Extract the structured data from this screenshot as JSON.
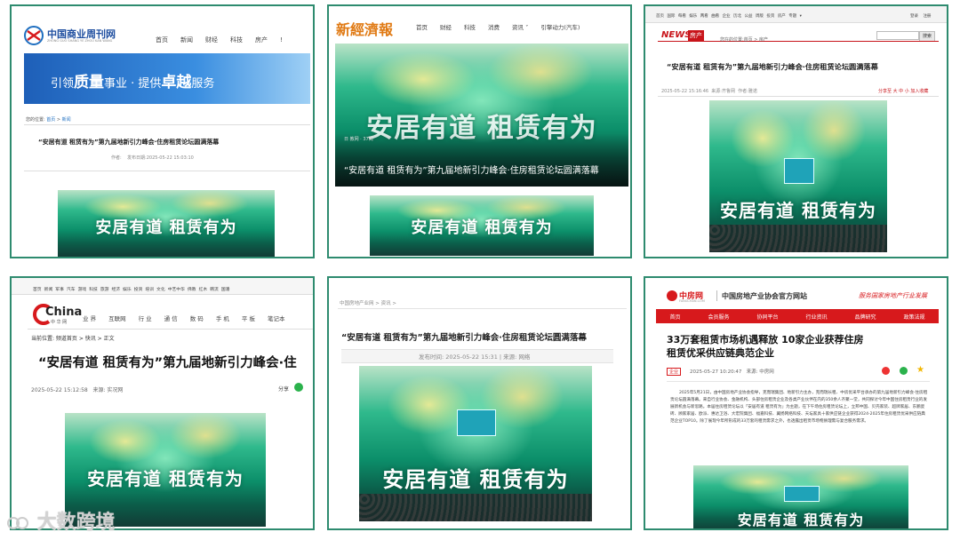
{
  "panel1": {
    "logo_text": "中国商业周刊网",
    "logo_sub": "ZHONG GUO SHANG YE ZHOU KAN WANG",
    "nav": [
      "首页",
      "新闻",
      "财经",
      "科技",
      "房产",
      "!"
    ],
    "banner": {
      "part1": "引领",
      "part2": "质量",
      "part3": "事业 · 提供",
      "part4": "卓越",
      "part5": "服务"
    },
    "breadcrumb_label": "您的位置:",
    "breadcrumb": [
      "首页",
      "新闻"
    ],
    "title": "“安居有道 租赁有为”第九届地新引力峰会·住房租赁论坛圆满落幕",
    "meta_author": "作者:",
    "meta_date": "发布日期:2025-05-22 15:03:10",
    "photo_text": "安居有道 租赁有为"
  },
  "panel2": {
    "logo_text": "新經濟報",
    "nav": [
      "首页",
      "财经",
      "科技",
      "消费",
      "资讯 ˅",
      "引擎动力(汽车)"
    ],
    "hero_source": "日 教网 · 37阅",
    "hero_title": "“安居有道 租赁有为”第九届地新引力峰会·住房租赁论坛圆满落幕",
    "hero_banner": "安居有道 租赁有为",
    "photo_text": "安居有道 租赁有为"
  },
  "panel3": {
    "topnav": [
      "首页",
      "国际",
      "每看",
      "娱乐",
      "两看",
      "曲看",
      "企业",
      "历北",
      "公益",
      "周版",
      "投资",
      "房产",
      "专题 ▾"
    ],
    "topnav_right": [
      "登录",
      "注册"
    ],
    "logo_news": "NEWS",
    "logo_tag": "房产",
    "search_button": "搜索",
    "breadcrumb": "您在的位置:首页 > 房产",
    "title": "“安居有道 租赁有为”第九届地新引力峰会·住房租赁论坛圆满落幕",
    "meta_date": "2025-05-22 15:16:46",
    "meta_source": "来源:齐鲁网",
    "meta_author": "作者:雅诺",
    "meta_right": "分享至  大 中 小  加入收藏",
    "photo_text": "安居有道 租赁有为"
  },
  "panel4": {
    "topnav": [
      "首页",
      "新闻",
      "军事",
      "汽车",
      "游戏",
      "科技",
      "旅游",
      "经济",
      "娱乐",
      "投资",
      "培训",
      "文化",
      "中艺中华",
      "佛教",
      "红木",
      "韩流",
      "国潘"
    ],
    "logo_text": "China",
    "logo_sub": "中 华 网",
    "nav": [
      "业 界",
      "互联网",
      "行 业",
      "通 信",
      "数 码",
      "手 机",
      "平 板",
      "笔记本"
    ],
    "breadcrumb": "当前位置: 频道首页 > 快讯 > 正文",
    "title": "“安居有道 租赁有为”第九届地新引力峰会·住",
    "meta_date": "2025-05-22 15:12:58",
    "meta_source": "来源: 实况网",
    "share_label": "分享",
    "photo_text": "安居有道 租赁有为"
  },
  "panel5": {
    "breadcrumb": "中国房地产业网 > 资讯 >",
    "title": "“安居有道 租赁有为”第九届地新引力峰会·住房租赁论坛圆满落幕",
    "meta": "发布时间: 2025-05-22 15:31 | 来源: 网络",
    "photo_text": "安居有道 租赁有为"
  },
  "panel6": {
    "logo_text": "中房网",
    "logo_sub": "FANGCHAN.COM",
    "site_title": "中国房地产业协会官方网站",
    "slogan": "服务国家房地产行业发展",
    "nav": [
      "首页",
      "会员服务",
      "协同平台",
      "行业资讯",
      "品牌研究",
      "政策法规"
    ],
    "title_line1": "33万套租赁市场机遇释放 10家企业获荐住房",
    "title_line2": "租赁优采供应链典范企业",
    "tag": "企业",
    "meta_date": "2025-05-27 10:20:47",
    "meta_source": "来源: 中房网",
    "body": "2025年5月21日，由中国房地产业协会指导，克而瑞集团、地新引力主办，克而瑞长租、中房优采平台承办的第九届地新引力峰会·住房租赁论坛圆满落幕。来自行业协会、金融机构、头部住房租赁企业及各类产业伙伴在内的350余人齐聚一堂，共同探讨今年中国住房租赁行业的发展新机会与新思路。本届住房租赁论坛以「安居有道 租赁有为」为主题，在下午场住房租赁论坛上，立邦中国、贝壳家装、超牌家居、东鹏瓷砖、顾家家居、欧派、惠达卫浴、大宏院集团、福嘉科技、翼扬网络科技、天坛家具十家供应链企业获得2024-2025年住房租赁优采供应链典范企业TOP10。除了展现今年所形成的33万套的租赁需求之外，也透露出租赁市场物质理需与复合服务需求。",
    "photo_text": "安居有道 租赁有为",
    "watermark_brand": "大数跨境"
  },
  "colors": {
    "border": "#2e8b6f",
    "red": "#d7191c",
    "blue_banner": "#1f6fc0"
  }
}
